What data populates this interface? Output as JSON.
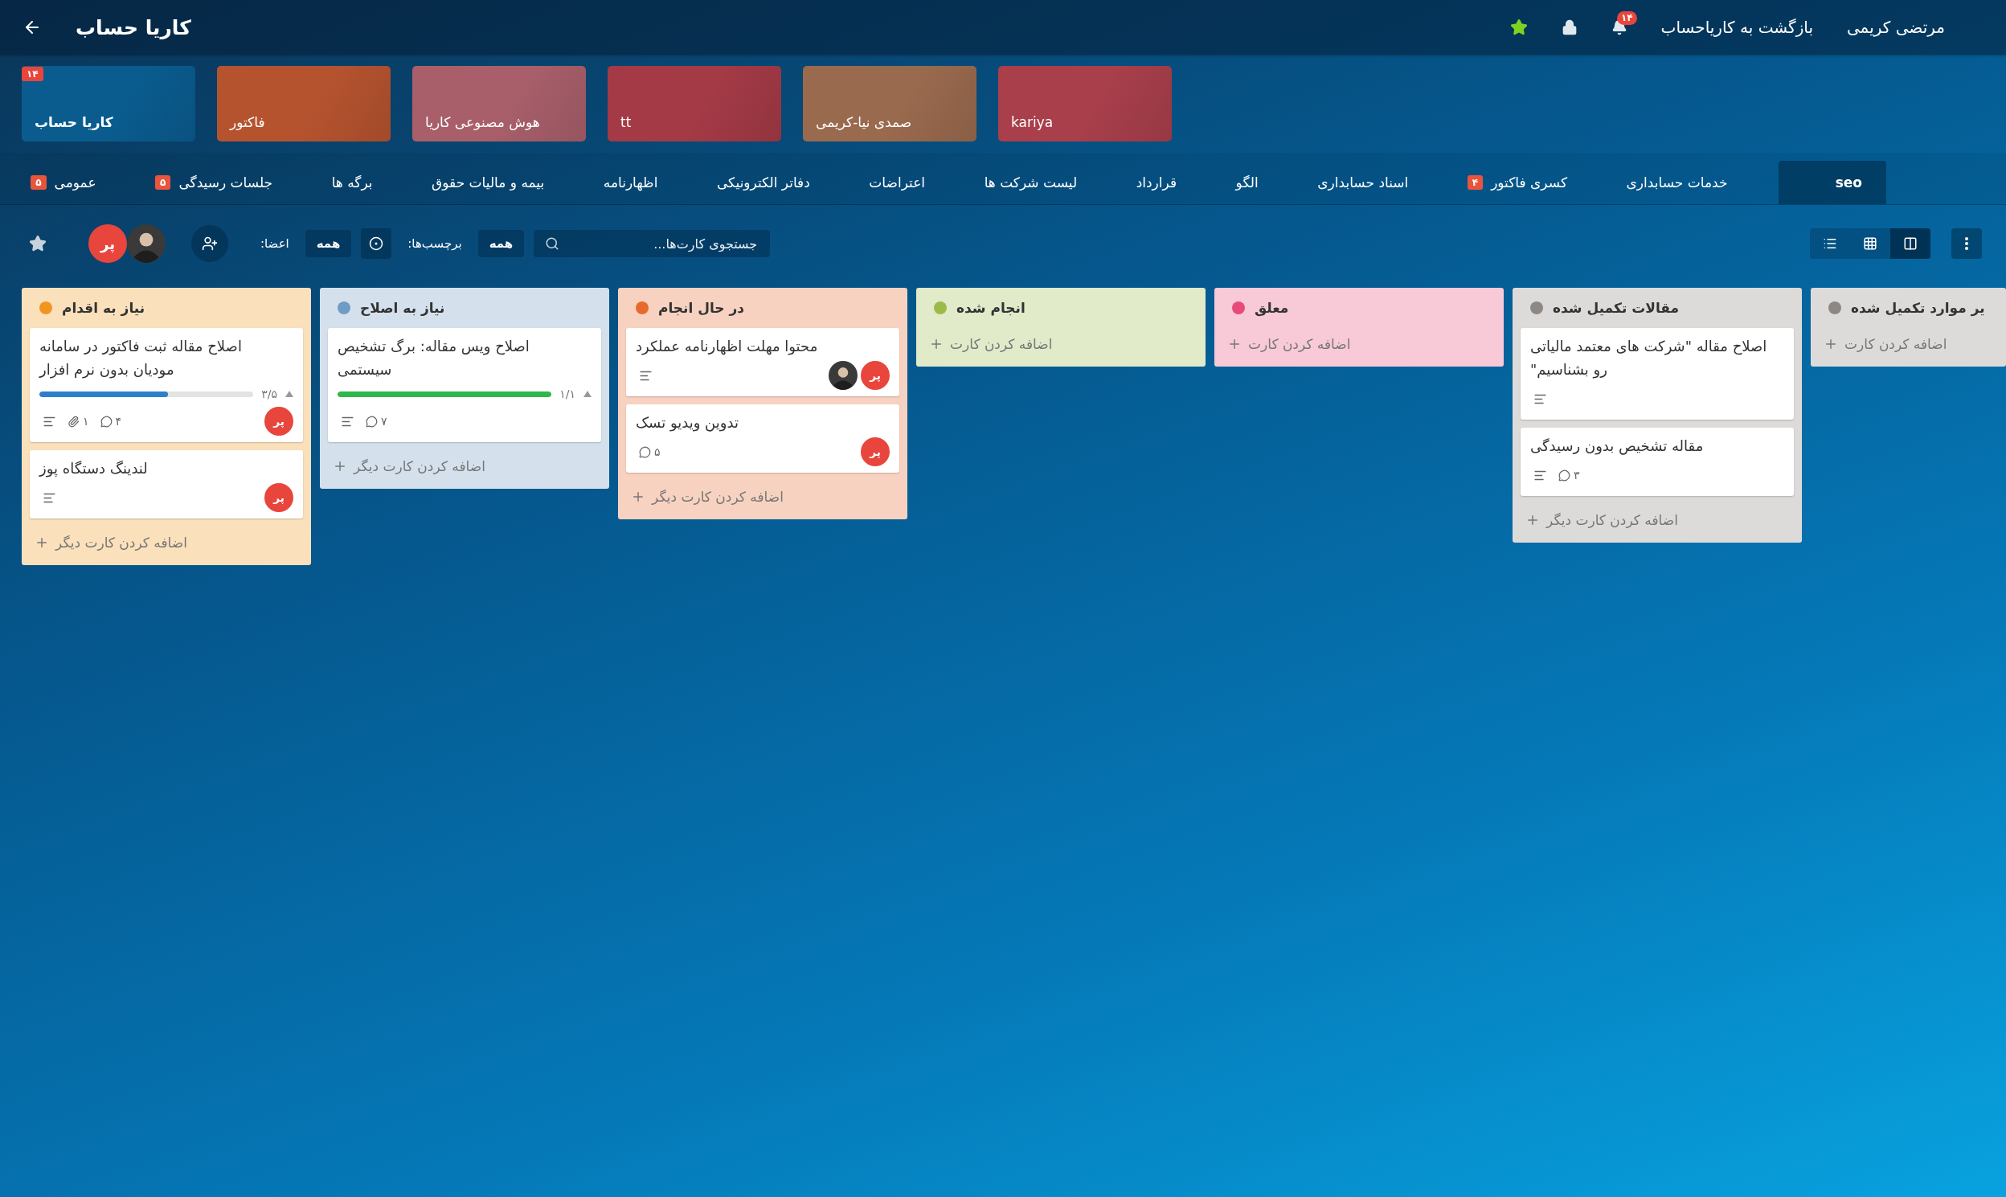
{
  "header": {
    "title": "کاریا حساب",
    "user_name": "مرتضی کریمی",
    "back_link": "بازگشت به کاریاحساب",
    "notification_count": "۱۴"
  },
  "boards": [
    {
      "name": "kariya",
      "color": "#a83f4b",
      "selected": false
    },
    {
      "name": "صمدی نیا-کریمی",
      "color": "#9a6a4e",
      "selected": false
    },
    {
      "name": "tt",
      "color": "#a33a46",
      "selected": false
    },
    {
      "name": "هوش مصنوعی کاریا",
      "color": "#a85f6a",
      "selected": false
    },
    {
      "name": "فاکتور",
      "color": "#b5532f",
      "selected": false
    },
    {
      "name": "کاریا حساب",
      "color": "#0a5c8f",
      "selected": true,
      "badge": "۱۴"
    }
  ],
  "tabs": [
    {
      "label": "seo",
      "selected": true
    },
    {
      "label": "خدمات حسابداری",
      "selected": false
    },
    {
      "label": "کسری فاکتور",
      "selected": false,
      "badge": "۴"
    },
    {
      "label": "اسناد حسابداری",
      "selected": false
    },
    {
      "label": "الگو",
      "selected": false
    },
    {
      "label": "قرارداد",
      "selected": false
    },
    {
      "label": "لیست شرکت ها",
      "selected": false
    },
    {
      "label": "اعتراضات",
      "selected": false
    },
    {
      "label": "دفاتر الکترونیکی",
      "selected": false
    },
    {
      "label": "اظهارنامه",
      "selected": false
    },
    {
      "label": "بیمه و مالیات حقوق",
      "selected": false
    },
    {
      "label": "برگه ها",
      "selected": false
    },
    {
      "label": "جلسات رسیدگی",
      "selected": false,
      "badge": "۵"
    },
    {
      "label": "عمومی",
      "selected": false,
      "badge": "۵"
    }
  ],
  "toolbar": {
    "search": {
      "placeholder": "جستجوی کارت‌ها..."
    },
    "labels_label": "برچسب‌ها:",
    "labels_value": "همه",
    "members_label": "اعضا:",
    "members_value": "همه",
    "members": [
      {
        "kind": "photo"
      },
      {
        "kind": "initials",
        "text": "پر"
      }
    ],
    "views": [
      {
        "kind": "board",
        "selected": true
      },
      {
        "kind": "grid",
        "selected": false
      },
      {
        "kind": "list",
        "selected": false
      }
    ]
  },
  "lists": [
    {
      "title": "یر موارد تکمیل شده",
      "color": "#8d8884",
      "add_label": "اضافه کردن کارت"
    },
    {
      "title": "مقالات تکمیل شده",
      "color": "#8d8884",
      "add_label": "اضافه کردن کارت دیگر",
      "cards": [
        {
          "title": "اصلاح مقاله \"شرکت های معتمد مالیاتی رو بشناسیم\"",
          "description": true
        },
        {
          "title": "مقاله تشخیص بدون رسیدگی",
          "description": true,
          "comments": "۳"
        }
      ]
    },
    {
      "title": "معلق",
      "color": "#e84a7a",
      "add_label": "اضافه کردن کارت"
    },
    {
      "title": "انجام شده",
      "color": "#9cba4a",
      "add_label": "اضافه کردن کارت"
    },
    {
      "title": "در حال انجام",
      "color": "#e8692e",
      "add_label": "اضافه کردن کارت دیگر",
      "cards": [
        {
          "title": "محتوا مهلت اظهارنامه عملکرد",
          "description": true,
          "members": [
            {
              "kind": "photo"
            },
            {
              "kind": "initials",
              "text": "پر"
            }
          ]
        },
        {
          "title": "تدوین ویدیو تسک",
          "description": false,
          "comments": "۵",
          "members": [
            {
              "kind": "initials",
              "text": "پر"
            }
          ]
        }
      ]
    },
    {
      "title": "نیاز به اصلاح",
      "color": "#6f9cc4",
      "add_label": "اضافه کردن کارت دیگر",
      "cards": [
        {
          "title": "اصلاح ویس مقاله: برگ تشخیص سیستمی",
          "checklist": {
            "text": "۱/۱",
            "level": 1
          },
          "description": true,
          "comments": "۷"
        }
      ]
    },
    {
      "title": "نیاز به اقدام",
      "color": "#f0961f",
      "add_label": "اضافه کردن کارت دیگر",
      "cards": [
        {
          "title": "اصلاح مقاله ثبت فاکتور در سامانه مودیان بدون نرم افزار",
          "checklist": {
            "text": "۳/۵",
            "level": 0.6
          },
          "description": true,
          "attachments": "۱",
          "comments": "۴",
          "members": [
            {
              "kind": "initials",
              "text": "پر"
            }
          ]
        },
        {
          "title": "لندینگ دستگاه پوز",
          "description": true,
          "members": [
            {
              "kind": "initials",
              "text": "پر"
            }
          ]
        }
      ]
    }
  ]
}
